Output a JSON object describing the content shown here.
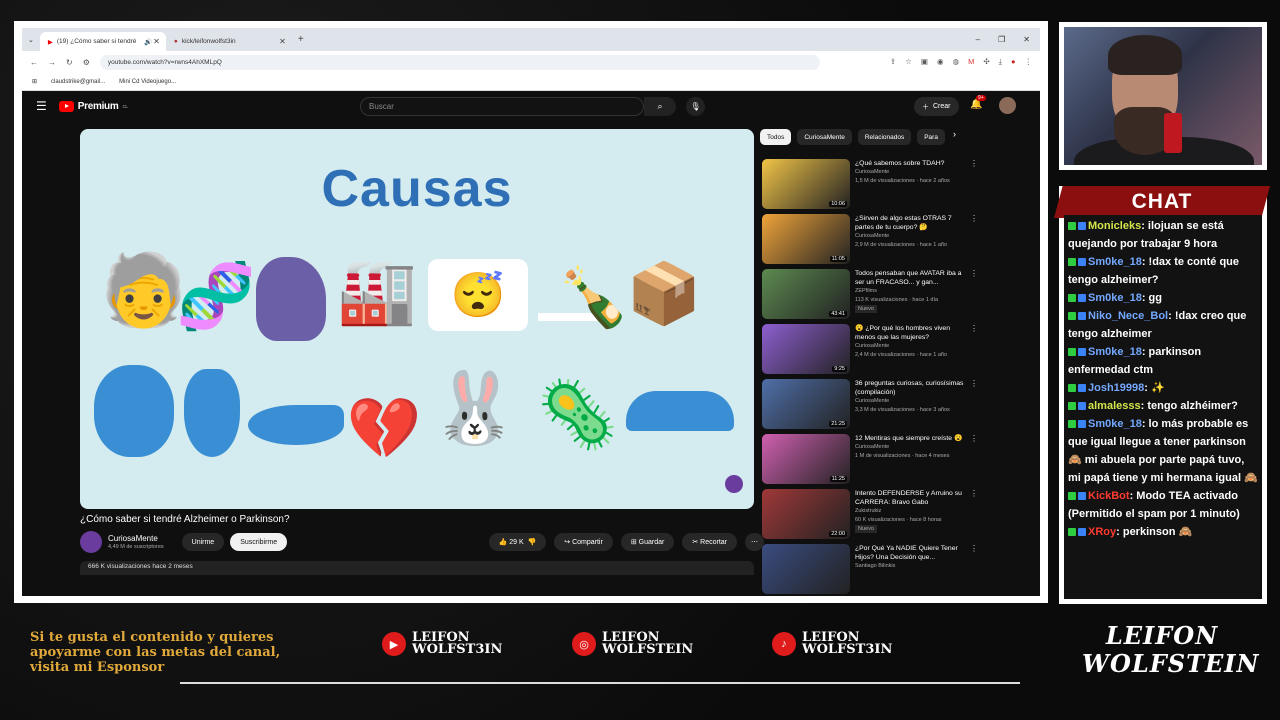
{
  "browser": {
    "tabs": [
      {
        "title": "(19) ¿Cómo saber si tendré",
        "active": true
      },
      {
        "title": "kick/leifonwolfst3in",
        "active": false
      }
    ],
    "url": "youtube.com/watch?v=rwns4AhXMLpQ",
    "bookmarks": [
      "claudstrike@gmail...",
      "Mini Cd Videojuego..."
    ]
  },
  "youtube": {
    "brand": "Premium",
    "brand_sup": "CL",
    "search_placeholder": "Buscar",
    "create_label": "Crear",
    "notif_count": "9+",
    "video_slide_title": "Causas",
    "video_title": "¿Cómo saber si tendré Alzheimer o Parkinson?",
    "channel": {
      "name": "CuriosaMente",
      "subs": "4,49 M de suscriptores"
    },
    "join_label": "Unirme",
    "subscribe_label": "Suscribirme",
    "likes": "29 K",
    "share_label": "Compartir",
    "save_label": "Guardar",
    "clip_label": "Recortar",
    "views_line": "666 K visualizaciones  hace 2 meses",
    "chips": [
      "Todos",
      "CuriosaMente",
      "Relacionados",
      "Para"
    ],
    "recommendations": [
      {
        "title": "¿Qué sabemos sobre TDAH?",
        "channel": "CuriosaMente",
        "meta": "1,5 M de visualizaciones · hace 2 años",
        "duration": "10:06",
        "color": "#f2c447"
      },
      {
        "title": "¿Sirven de algo estas OTRAS 7 partes de tu cuerpo? 🤔",
        "channel": "CuriosaMente",
        "meta": "2,9 M de visualizaciones · hace 1 año",
        "duration": "11:05",
        "color": "#f0a43a"
      },
      {
        "title": "Todos pensaban que AVATAR iba a ser un FRACASO... y gan...",
        "channel": "ZEPfilms",
        "meta": "113 K visualizaciones · hace 1 día",
        "duration": "43:41",
        "color": "#5c8a50",
        "badge": "Nuevo"
      },
      {
        "title": "😮 ¿Por qué los hombres viven menos que las mujeres?",
        "channel": "CuriosaMente",
        "meta": "2,4 M de visualizaciones · hace 1 año",
        "duration": "9:25",
        "color": "#8e5fd0"
      },
      {
        "title": "36 preguntas curiosas, curiosísimas (compilación)",
        "channel": "CuriosaMente",
        "meta": "3,3 M de visualizaciones · hace 3 años",
        "duration": "21:25",
        "color": "#4f6fa8"
      },
      {
        "title": "12 Mentiras que siempre creíste 😮",
        "channel": "CuriosaMente",
        "meta": "1 M de visualizaciones · hace 4 meses",
        "duration": "11:25",
        "color": "#d060b0"
      },
      {
        "title": "Intento DEFENDERSE y Arruino su CARRERA: Bravo Gabo",
        "channel": "Zukistrukiz",
        "meta": "60 K visualizaciones · hace 8 horas",
        "duration": "22:00",
        "color": "#a03838",
        "badge": "Nuevo"
      },
      {
        "title": "¿Por Qué Ya NADIE Quiere Tener Hijos? Una Decisión que...",
        "channel": "Santiago Bilinkis",
        "meta": "",
        "duration": "",
        "color": "#3a4c80"
      }
    ]
  },
  "chat": {
    "header": "CHAT",
    "messages": [
      {
        "user": "Monicleks",
        "text": ": ilojuan se está quejando por trabajar 9 hora",
        "color": "g"
      },
      {
        "user": "Sm0ke_18",
        "text": ": !dax te conté que tengo alzheimer?",
        "color": ""
      },
      {
        "user": "Sm0ke_18",
        "text": ": gg",
        "color": ""
      },
      {
        "user": "Niko_Nece_Bol",
        "text": ": !dax creo que tengo alzheimer",
        "color": ""
      },
      {
        "user": "Sm0ke_18",
        "text": ": parkinson enfermedad ctm",
        "color": ""
      },
      {
        "user": "Josh19998",
        "text": ": ✨",
        "color": ""
      },
      {
        "user": "almalesss",
        "text": ": tengo alzhéimer?",
        "color": "g"
      },
      {
        "user": "Sm0ke_18",
        "text": ": lo más probable es que igual llegue a tener parkinson 🙈 mi abuela por parte papá tuvo, mi papá tiene y mi hermana igual 🙈",
        "color": ""
      },
      {
        "user": "KickBot",
        "text": ": Modo TEA activado (Permitido el spam por 1 minuto)",
        "color": "r"
      },
      {
        "user": "XRoy",
        "text": ": perkinson 🙈",
        "color": "r"
      }
    ]
  },
  "overlay": {
    "sponsor_text": "Si te gusta el contenido y quieres apoyarme con las metas del canal, visita mi Esponsor",
    "socials": [
      {
        "icon": "youtube-icon",
        "l1": "LEIFON",
        "l2": "WOLFST3IN"
      },
      {
        "icon": "instagram-icon",
        "l1": "LEIFON",
        "l2": "WOLFSTEIN"
      },
      {
        "icon": "tiktok-icon",
        "l1": "LEIFON",
        "l2": "WOLFST3IN"
      }
    ],
    "brand_l1": "LEIFON",
    "brand_l2": "WOLFSTEIN"
  }
}
